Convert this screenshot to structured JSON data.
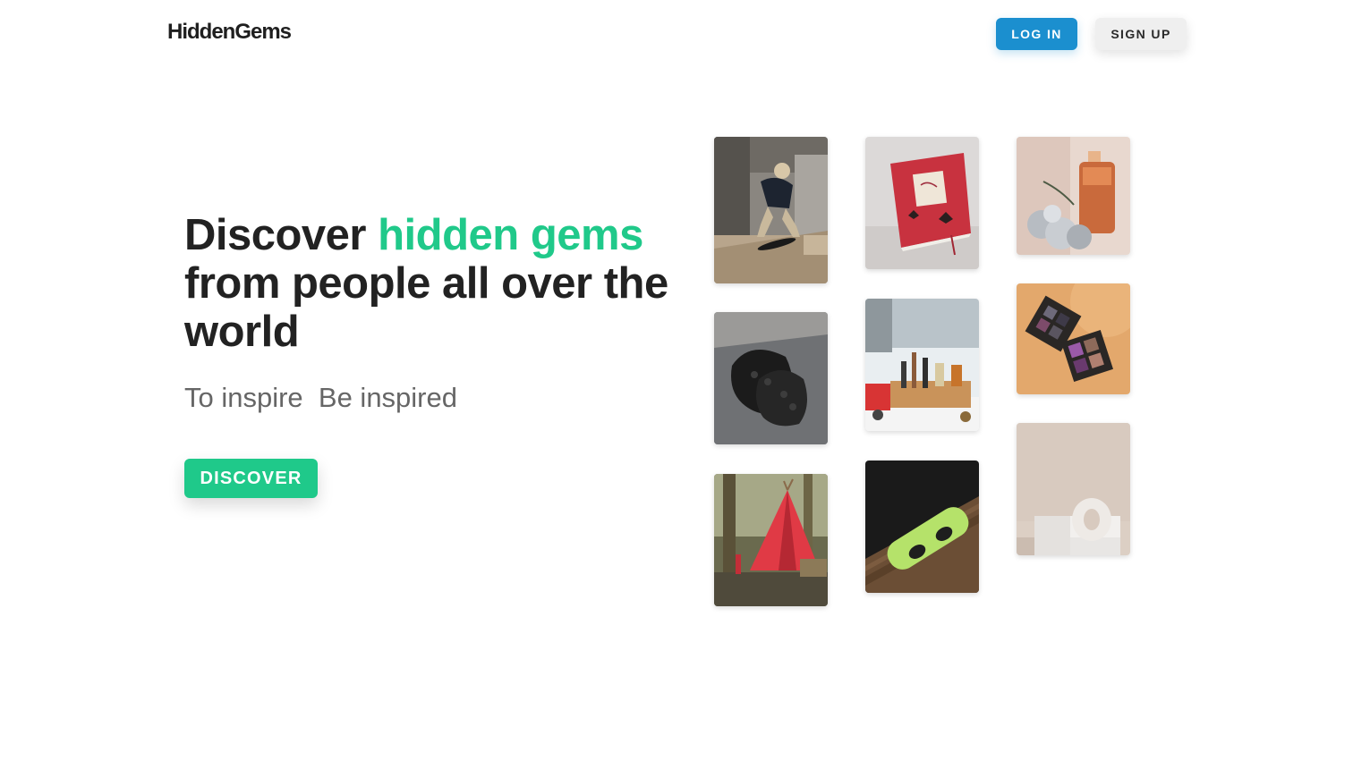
{
  "header": {
    "logo": "HiddenGems",
    "login_label": "LOG IN",
    "signup_label": "SIGN UP"
  },
  "hero": {
    "headline_start": "Discover ",
    "headline_accent": "hidden gems",
    "headline_end": " from people all over the world",
    "tagline": "To inspire  Be inspired",
    "cta_label": "DISCOVER"
  },
  "colors": {
    "accent_green": "#20c98a",
    "login_blue": "#1b8fcf",
    "signup_gray": "#efefef"
  },
  "gallery": {
    "images": [
      {
        "name": "skateboarder-photo"
      },
      {
        "name": "notebook-photo"
      },
      {
        "name": "perfume-photo"
      },
      {
        "name": "black-clogs-photo"
      },
      {
        "name": "craft-supplies-photo"
      },
      {
        "name": "eyeshadow-palette-photo"
      },
      {
        "name": "red-teepee-photo"
      },
      {
        "name": "wakeboard-photo"
      },
      {
        "name": "ceramic-vase-photo"
      }
    ]
  }
}
